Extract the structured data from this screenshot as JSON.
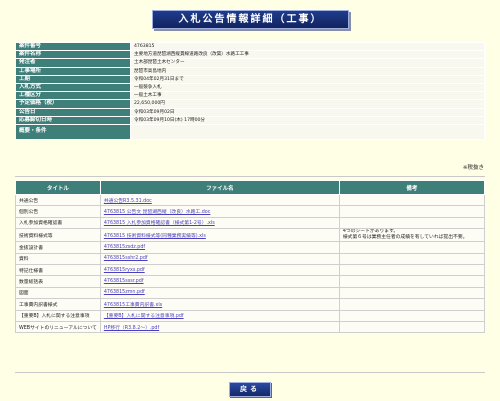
{
  "page_title": "入札公告情報詳細（工事）",
  "info": [
    {
      "label": "案件番号",
      "value": "4763815"
    },
    {
      "label": "案件名称",
      "value": "主要地方道琵琶湖西縦貫線道路改良（改築）水路工工事"
    },
    {
      "label": "発注者",
      "value": "土木部琵琶土木センター"
    },
    {
      "label": "工事場所",
      "value": "琵琶市高島地内"
    },
    {
      "label": "工期",
      "value": "令和04年02月31日まで"
    },
    {
      "label": "入札方式",
      "value": "一般競争入札"
    },
    {
      "label": "工種区分",
      "value": "一般土木工事"
    },
    {
      "label": "予定価格（税）",
      "value": "22,650,000円"
    },
    {
      "label": "公告日",
      "value": "令和03年09月02日"
    },
    {
      "label": "応募締切日時",
      "value": "令和03年09月10日(木) 17時00分"
    },
    {
      "label": "概要・条件",
      "value": ""
    }
  ],
  "tax_note": "※税抜き",
  "files_header": {
    "title": "タイトル",
    "filename": "ファイル名",
    "remarks": "備考"
  },
  "files": [
    {
      "title": "共通公告",
      "file": "共通公告R3.5.31.doc",
      "remark": ""
    },
    {
      "title": "個別公告",
      "file": "4763815 公告文 琵琶湖西縦（改良）水路工.doc",
      "remark": ""
    },
    {
      "title": "入札参加資格確認書",
      "file": "4763815 入札参加資格確認書（様式第1-2号）.xls",
      "remark": ""
    },
    {
      "title": "技術資料様式等",
      "file": "4763815 技術資料様式等(同種業務実績等).xls",
      "remark": "4つのシートがあります。\n様式第６号は業務主任者の成績を有していれば提出不要。"
    },
    {
      "title": "金抜設計書",
      "file": "4763815zsdz.pdf",
      "remark": ""
    },
    {
      "title": "資料",
      "file": "4763815sshr2.pdf",
      "remark": ""
    },
    {
      "title": "特記仕様書",
      "file": "4763815ryxs.pdf",
      "remark": ""
    },
    {
      "title": "数量総括表",
      "file": "4763815sssr.pdf",
      "remark": ""
    },
    {
      "title": "図面",
      "file": "4763815zmn.pdf",
      "remark": ""
    },
    {
      "title": "工事費内訳書様式",
      "file": "4763815工事費内訳書.xls",
      "remark": ""
    },
    {
      "title": "【重要B】入札に関する注意事項",
      "file": "【重要B】入札に関する注意事項.pdf",
      "remark": ""
    },
    {
      "title": "WEBサイトのリニューアルについて",
      "file": "HP移行（R3.8.2〜）.pdf",
      "remark": ""
    }
  ],
  "back_button": "戻る"
}
